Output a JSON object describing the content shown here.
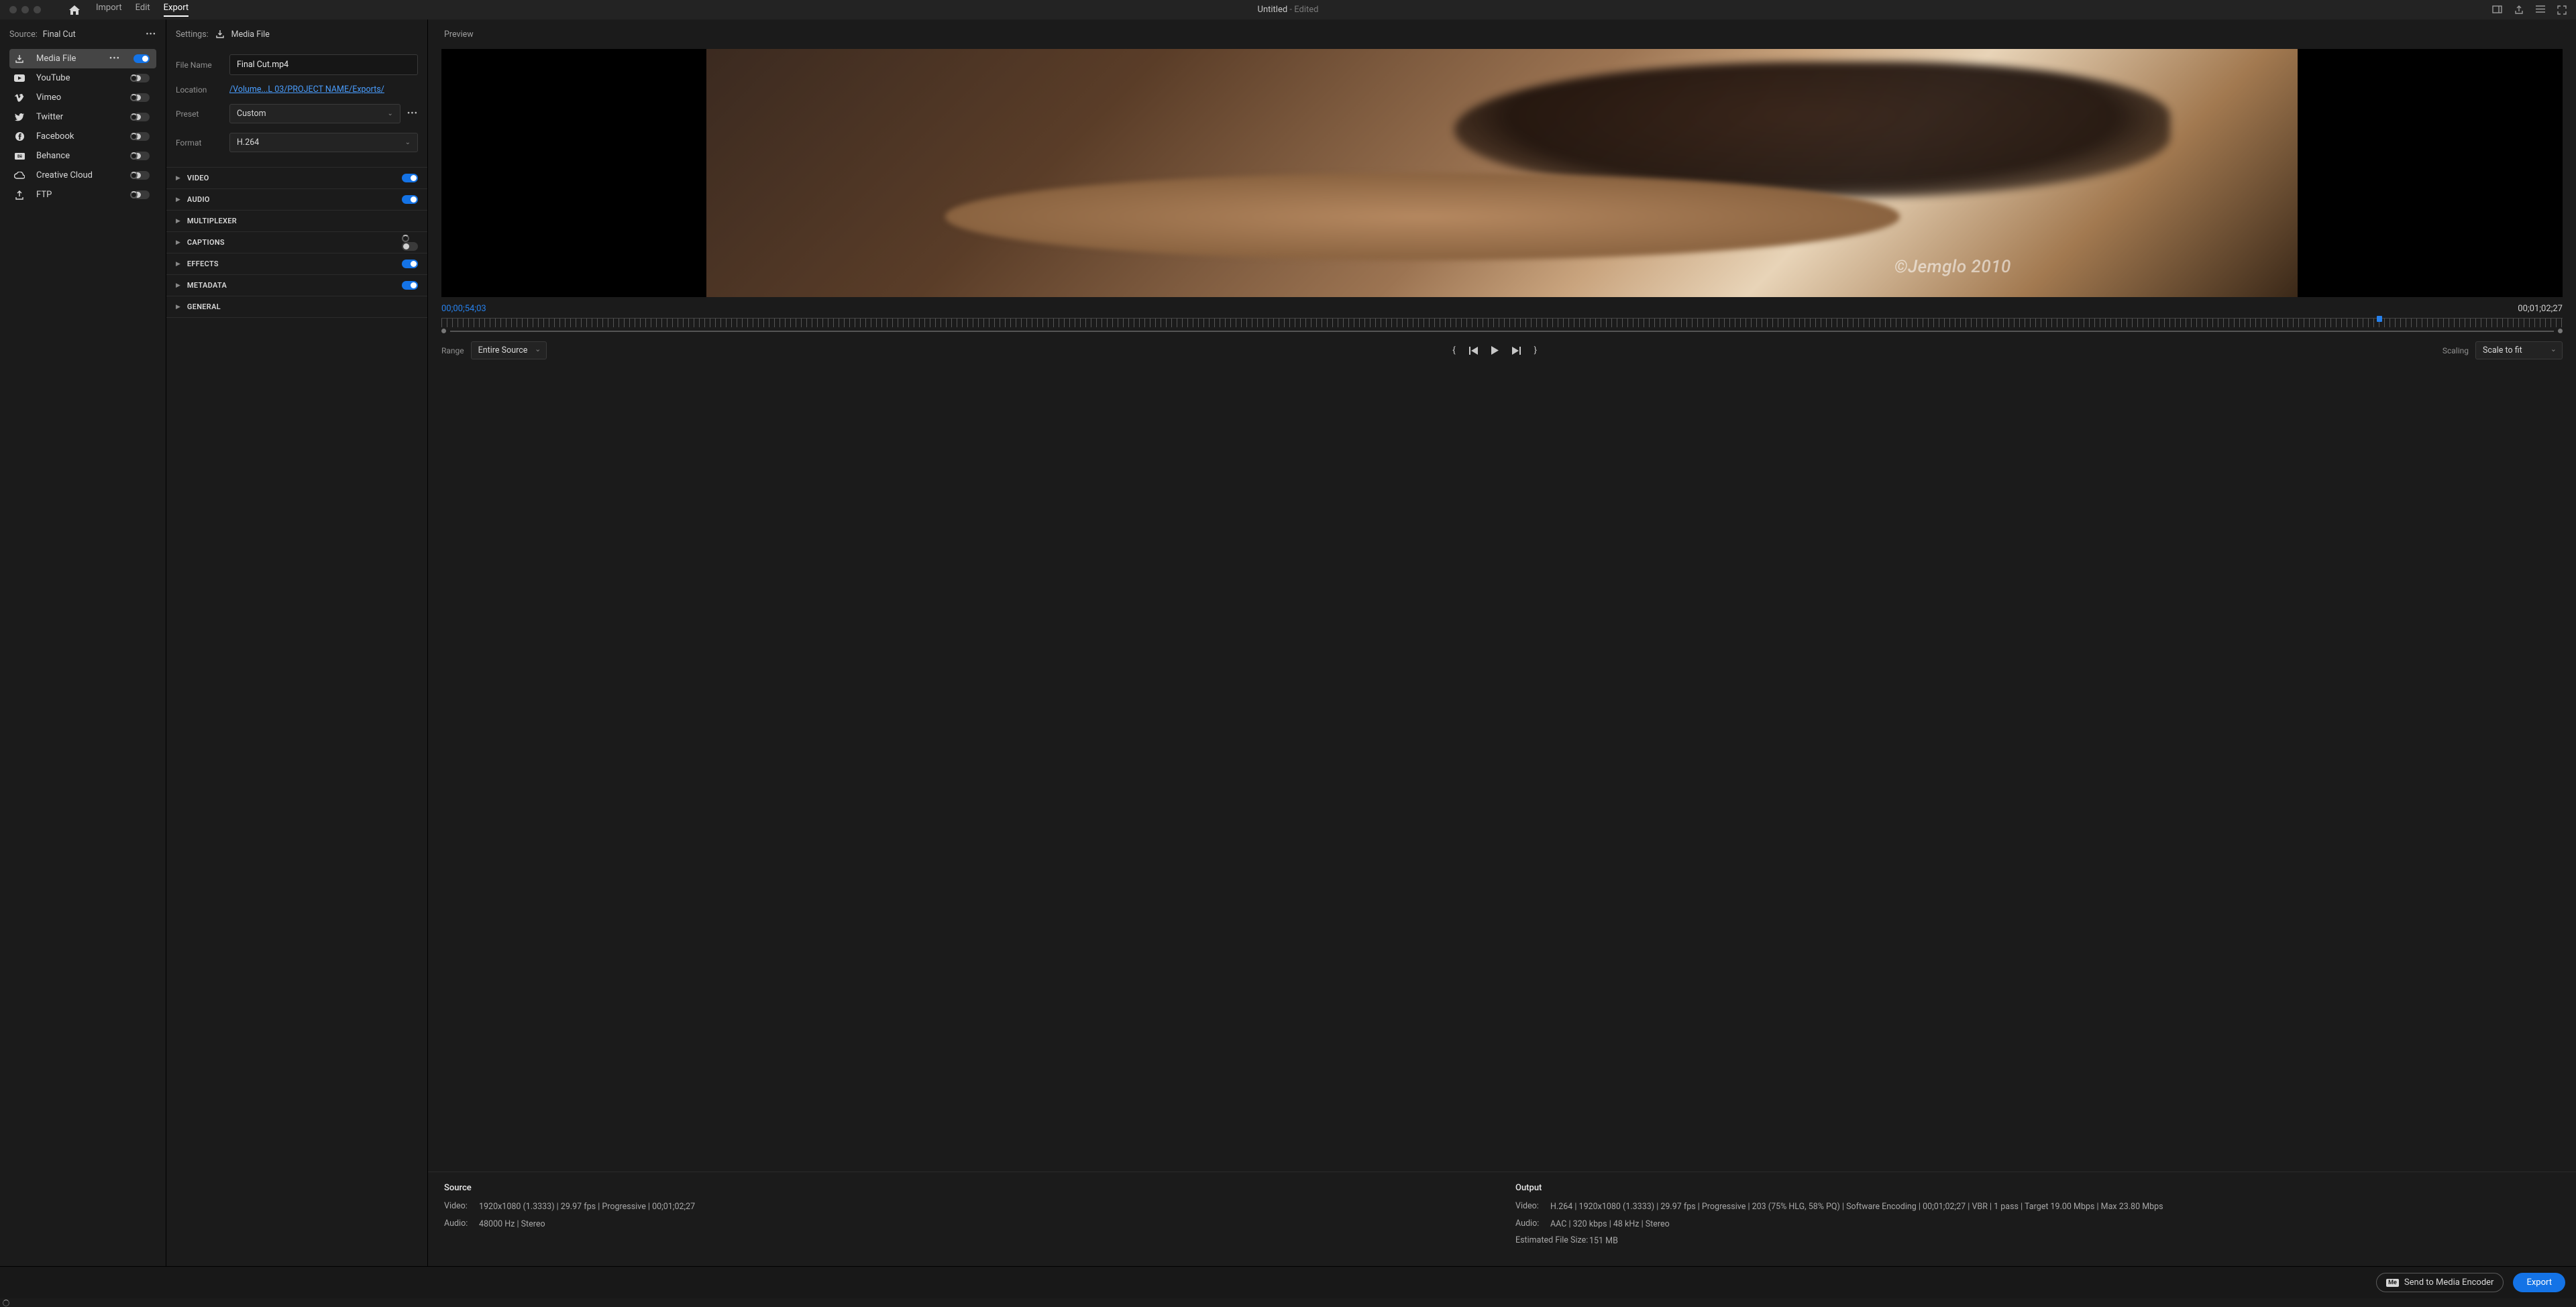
{
  "title": {
    "name": "Untitled",
    "suffix": " - Edited"
  },
  "nav": {
    "import": "Import",
    "edit": "Edit",
    "export": "Export"
  },
  "source": {
    "label": "Source:",
    "value": "Final Cut"
  },
  "destinations": [
    {
      "name": "Media File",
      "on": true,
      "selected": true
    },
    {
      "name": "YouTube",
      "on": false
    },
    {
      "name": "Vimeo",
      "on": false
    },
    {
      "name": "Twitter",
      "on": false
    },
    {
      "name": "Facebook",
      "on": false
    },
    {
      "name": "Behance",
      "on": false
    },
    {
      "name": "Creative Cloud",
      "on": false
    },
    {
      "name": "FTP",
      "on": false
    }
  ],
  "settings": {
    "header": "Settings:",
    "target": "Media File",
    "fileName": {
      "label": "File Name",
      "value": "Final Cut.mp4"
    },
    "location": {
      "label": "Location",
      "value": "/Volume...L 03/PROJECT NAME/Exports/"
    },
    "preset": {
      "label": "Preset",
      "value": "Custom"
    },
    "format": {
      "label": "Format",
      "value": "H.264"
    }
  },
  "accordion": [
    {
      "name": "VIDEO",
      "toggle": true
    },
    {
      "name": "AUDIO",
      "toggle": true
    },
    {
      "name": "MULTIPLEXER"
    },
    {
      "name": "CAPTIONS",
      "toggle": false
    },
    {
      "name": "EFFECTS",
      "toggle": true
    },
    {
      "name": "METADATA",
      "toggle": true
    },
    {
      "name": "GENERAL"
    }
  ],
  "preview": {
    "header": "Preview",
    "watermark": "©Jemglo 2010",
    "timeCurrent": "00;00;54;03",
    "timeEnd": "00;01;02;27",
    "rangeLabel": "Range",
    "rangeValue": "Entire Source",
    "scalingLabel": "Scaling",
    "scalingValue": "Scale to fit"
  },
  "summary": {
    "source": {
      "title": "Source",
      "videoLabel": "Video:",
      "video": "1920x1080 (1.3333) | 29.97 fps | Progressive | 00;01;02;27",
      "audioLabel": "Audio:",
      "audio": "48000 Hz | Stereo"
    },
    "output": {
      "title": "Output",
      "videoLabel": "Video:",
      "video": "H.264 | 1920x1080 (1.3333) | 29.97 fps | Progressive | 203 (75% HLG, 58% PQ) | Software Encoding | 00;01;02;27 | VBR | 1 pass | Target 19.00 Mbps | Max 23.80 Mbps",
      "audioLabel": "Audio:",
      "audio": "AAC | 320 kbps | 48 kHz | Stereo",
      "estLabel": "Estimated File Size:",
      "estValue": "151 MB"
    }
  },
  "footer": {
    "sendEncoder": "Send to Media Encoder",
    "export": "Export"
  }
}
